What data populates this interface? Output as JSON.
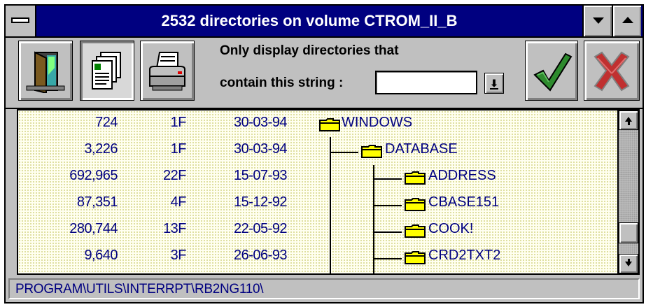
{
  "window": {
    "title": "2532 directories on volume CTROM_II_B"
  },
  "titlebar_buttons": {
    "system_menu_icon": "system-menu-bar",
    "minimize_icon": "triangle-down",
    "maximize_icon": "triangle-up"
  },
  "toolbar": {
    "exit_icon": "door-exit",
    "documents_icon": "documents",
    "print_icon": "printer",
    "ok_icon": "green-checkmark",
    "cancel_icon": "red-x",
    "filter_label_line1": "Only display directories that",
    "filter_label_line2": "contain this string :",
    "filter_value": "",
    "filter_dropdown_icon": "arrow-down-underline",
    "colors": {
      "ok": "#2e8b2e",
      "cancel": "#c03030"
    }
  },
  "directories": [
    {
      "size": "724",
      "files": "1F",
      "date": "30-03-94",
      "name": "WINDOWS"
    },
    {
      "size": "3,226",
      "files": "1F",
      "date": "30-03-94",
      "name": "DATABASE"
    },
    {
      "size": "692,965",
      "files": "22F",
      "date": "15-07-93",
      "name": "ADDRESS"
    },
    {
      "size": "87,351",
      "files": "4F",
      "date": "15-12-92",
      "name": "CBASE151"
    },
    {
      "size": "280,744",
      "files": "13F",
      "date": "22-05-92",
      "name": "COOK!"
    },
    {
      "size": "9,640",
      "files": "3F",
      "date": "26-06-93",
      "name": "CRD2TXT2"
    }
  ],
  "list_colors": {
    "text": "#000080",
    "folder": "#ffff00"
  },
  "scrollbar": {
    "up_icon": "arrow-up",
    "down_icon": "arrow-down"
  },
  "status": {
    "path": "PROGRAM\\UTILS\\INTERRPT\\RB2NG110\\"
  }
}
